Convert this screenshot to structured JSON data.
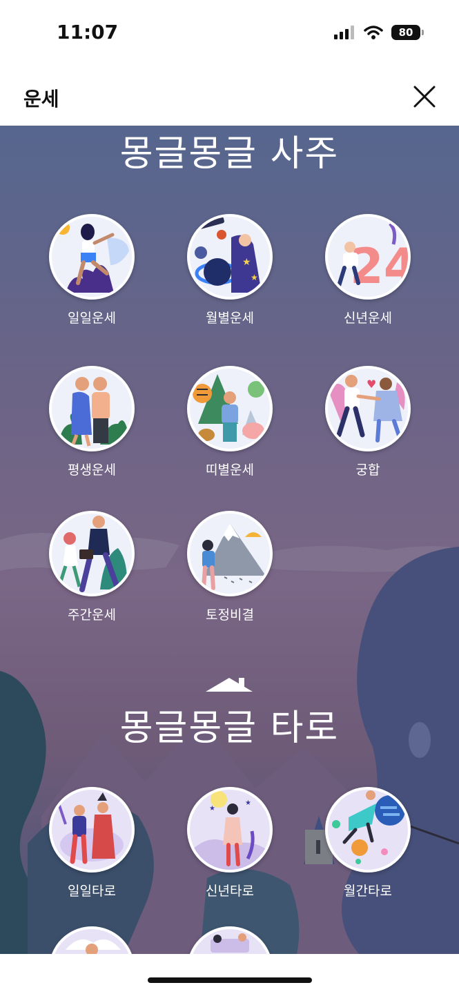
{
  "status": {
    "time": "11:07",
    "battery": "80"
  },
  "header": {
    "title": "운세"
  },
  "saju": {
    "title": "몽글몽글 사주",
    "items": [
      {
        "label": "일일운세",
        "icon": "daily-fortune-icon"
      },
      {
        "label": "월별운세",
        "icon": "monthly-fortune-icon"
      },
      {
        "label": "신년운세",
        "icon": "new-year-fortune-icon"
      },
      {
        "label": "평생운세",
        "icon": "lifetime-fortune-icon"
      },
      {
        "label": "띠별운세",
        "icon": "zodiac-fortune-icon"
      },
      {
        "label": "궁합",
        "icon": "compatibility-icon"
      },
      {
        "label": "주간운세",
        "icon": "weekly-fortune-icon"
      },
      {
        "label": "토정비결",
        "icon": "tojeong-icon"
      }
    ]
  },
  "tarot": {
    "title": "몽글몽글 타로",
    "items": [
      {
        "label": "일일타로",
        "icon": "daily-tarot-icon"
      },
      {
        "label": "신년타로",
        "icon": "new-year-tarot-icon"
      },
      {
        "label": "월간타로",
        "icon": "monthly-tarot-icon"
      }
    ]
  },
  "colors": {
    "header_bg": "#ffffff",
    "bg_top": "#56668f",
    "bg_bottom": "#4c5478",
    "label_text": "#ffffff"
  }
}
